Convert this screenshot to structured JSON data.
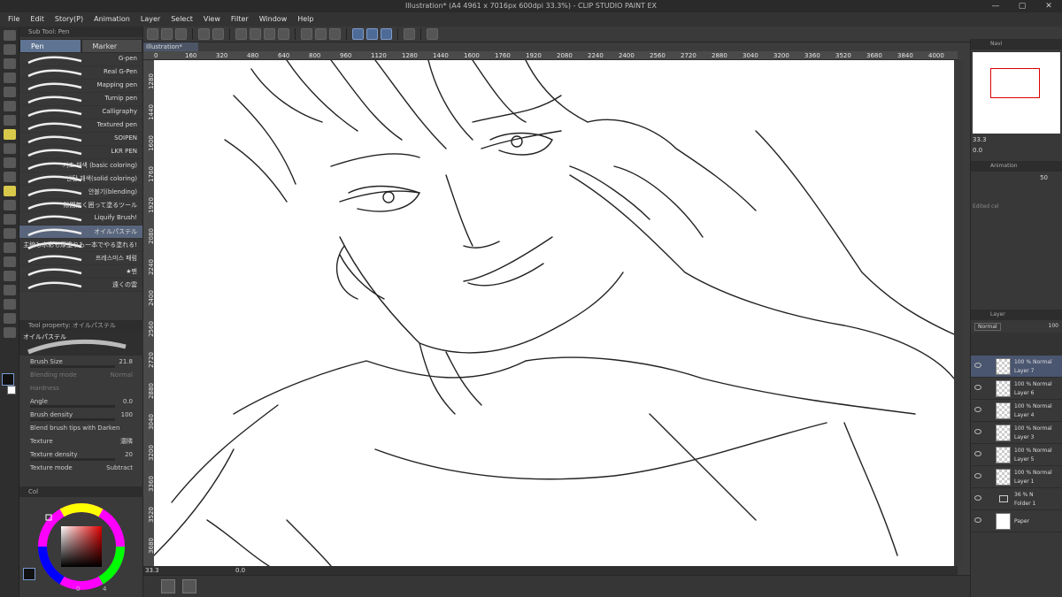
{
  "window": {
    "title": "Illustration* (A4 4961 x 7016px 600dpi 33.3%) - CLIP STUDIO PAINT EX"
  },
  "menu": [
    "File",
    "Edit",
    "Story(P)",
    "Animation",
    "Layer",
    "Select",
    "View",
    "Filter",
    "Window",
    "Help"
  ],
  "subtool": {
    "title": "Sub Tool: Pen",
    "tabs": [
      "Pen",
      "Marker"
    ],
    "brushes": [
      "G-pen",
      "Real G-Pen",
      "Mapping pen",
      "Turnip pen",
      "Calligraphy",
      "Textured pen",
      "SOIPEN",
      "LKR PEN",
      "기초 채색 (basic coloring)",
      "반탄 채색(solid coloring)",
      "안블기(blending)",
      "隙間無く囲って塗るツール",
      "Liquify Brush!",
      "オイルパステル",
      "主線も水彩も厚塗りも一本でやる塗れる!",
      "프레스미스 패럼",
      "★펜",
      "遠くの雲"
    ],
    "active_brush": 13
  },
  "toolprop": {
    "title": "Tool property: オイルパステル",
    "brush_name": "オイルパステル",
    "brush_size_label": "Brush Size",
    "brush_size": "21.8",
    "blending_label": "Blending mode",
    "blending": "Normal",
    "hardness_label": "Hardness",
    "angle_label": "Angle",
    "angle": "0.0",
    "density_label": "Brush density",
    "density": "100",
    "blend_tips": "Blend brush tips with Darken",
    "texture_label": "Texture",
    "texture": "濃隣",
    "tex_density_label": "Texture density",
    "tex_density": "20",
    "tex_mode_label": "Texture mode",
    "tex_mode": "Subtract"
  },
  "color": {
    "tab": "Col",
    "foreground": "#111111",
    "background": "#ffffff",
    "readout": "0",
    "readout2": "4"
  },
  "doc": {
    "tab": "Illustration*"
  },
  "rulers": {
    "h": [
      "0",
      "160",
      "320",
      "480",
      "640",
      "800",
      "960",
      "1120",
      "1280",
      "1440",
      "1600",
      "1760",
      "1920",
      "2080",
      "2240",
      "2400",
      "2560",
      "2720",
      "2880",
      "3040",
      "3200",
      "3360",
      "3520",
      "3680",
      "3840",
      "4000",
      "4160"
    ],
    "v": [
      "1280",
      "1440",
      "1600",
      "1760",
      "1920",
      "2080",
      "2240",
      "2400",
      "2560",
      "2720",
      "2880",
      "3040",
      "3200",
      "3360",
      "3520",
      "3680"
    ]
  },
  "status": {
    "zoom": "33.3",
    "angle": "0.0"
  },
  "navigator": {
    "tab": "Navi",
    "zoom": "33.3",
    "angle": "0.0"
  },
  "animation": {
    "tab": "Animation",
    "opacity": "50",
    "edited": "Edited cel"
  },
  "layers": {
    "tab": "Layer",
    "blend": "Normal",
    "opacity": "100",
    "rows": [
      {
        "mode": "100 % Normal",
        "name": "Layer 7",
        "selected": true
      },
      {
        "mode": "100 % Normal",
        "name": "Layer 6",
        "selected": false
      },
      {
        "mode": "100 % Normal",
        "name": "Layer 4",
        "selected": false
      },
      {
        "mode": "100 % Normal",
        "name": "Layer 3",
        "selected": false
      },
      {
        "mode": "100 % Normal",
        "name": "Layer 5",
        "selected": false
      },
      {
        "mode": "100 % Normal",
        "name": "Layer 1",
        "selected": false
      }
    ],
    "folder": {
      "mode": "36 % N",
      "name": "Folder 1"
    },
    "paper": {
      "name": "Paper"
    }
  }
}
